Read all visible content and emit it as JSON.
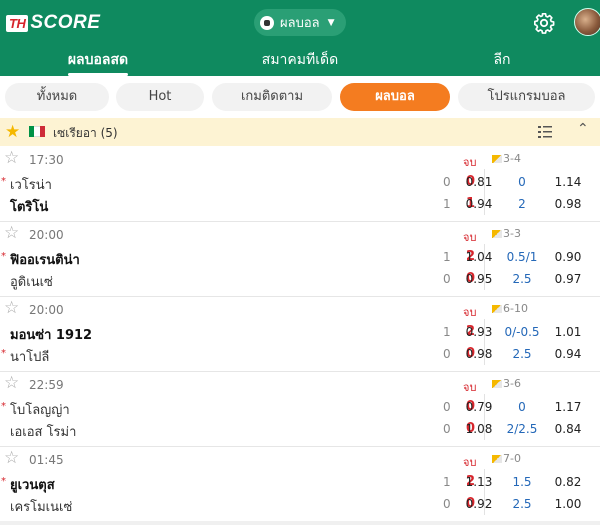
{
  "header": {
    "logo_th": "TH",
    "logo_score": "SCORE",
    "sport": "ผลบอล",
    "icons": {
      "settings": "gear-icon",
      "avatar": "user-avatar"
    }
  },
  "tabs": [
    {
      "label": "ผลบอลสด",
      "active": true
    },
    {
      "label": "สมาคมทีเด็ด",
      "active": false,
      "badge": "flame-icon"
    },
    {
      "label": "ลีก",
      "active": false
    }
  ],
  "filters": [
    {
      "label": "ทั้งหมด",
      "active": false
    },
    {
      "label": "Hot",
      "active": false
    },
    {
      "label": "เกมติดตาม",
      "active": false
    },
    {
      "label": "ผลบอล",
      "active": true
    },
    {
      "label": "โปรแกรมบอล",
      "active": false
    }
  ],
  "league": {
    "name": "เซเรียอา (5)",
    "flag_colors": [
      "#009246",
      "#ffffff",
      "#ce2b37"
    ]
  },
  "matches": [
    {
      "time": "17:30",
      "status": "จบ",
      "handicap": "3-4",
      "home": {
        "name": "เวโรน่า",
        "ht": "0",
        "ft": "0",
        "red": true,
        "win": false
      },
      "away": {
        "name": "โตริโน่",
        "ht": "1",
        "ft": "1",
        "red": false,
        "win": true
      },
      "odds_top": [
        "0.81",
        "0",
        "1.14"
      ],
      "odds_bottom": [
        "0.94",
        "2",
        "0.98"
      ]
    },
    {
      "time": "20:00",
      "status": "จบ",
      "handicap": "3-3",
      "home": {
        "name": "ฟิออเรนติน่า",
        "ht": "1",
        "ft": "2",
        "red": true,
        "win": true
      },
      "away": {
        "name": "อูดิเนเซ่",
        "ht": "0",
        "ft": "0",
        "red": false,
        "win": false
      },
      "odds_top": [
        "1.04",
        "0.5/1",
        "0.90"
      ],
      "odds_bottom": [
        "0.95",
        "2.5",
        "0.97"
      ]
    },
    {
      "time": "20:00",
      "status": "จบ",
      "handicap": "6-10",
      "home": {
        "name": "มอนซ่า 1912",
        "ht": "1",
        "ft": "2",
        "red": false,
        "win": true
      },
      "away": {
        "name": "นาโปลี",
        "ht": "0",
        "ft": "0",
        "red": true,
        "win": false
      },
      "odds_top": [
        "0.93",
        "0/-0.5",
        "1.01"
      ],
      "odds_bottom": [
        "0.98",
        "2.5",
        "0.94"
      ]
    },
    {
      "time": "22:59",
      "status": "จบ",
      "handicap": "3-6",
      "home": {
        "name": "โบโลญญ่า",
        "ht": "0",
        "ft": "0",
        "red": true,
        "win": false
      },
      "away": {
        "name": "เอเอส โรม่า",
        "ht": "0",
        "ft": "0",
        "red": false,
        "win": false
      },
      "odds_top": [
        "0.79",
        "0",
        "1.17"
      ],
      "odds_bottom": [
        "1.08",
        "2/2.5",
        "0.84"
      ]
    },
    {
      "time": "01:45",
      "status": "จบ",
      "handicap": "7-0",
      "home": {
        "name": "ยูเวนตุส",
        "ht": "1",
        "ft": "2",
        "red": true,
        "win": true
      },
      "away": {
        "name": "เครโมเนเซ่",
        "ht": "0",
        "ft": "0",
        "red": false,
        "win": false
      },
      "odds_top": [
        "1.13",
        "1.5",
        "0.82"
      ],
      "odds_bottom": [
        "0.92",
        "2.5",
        "1.00"
      ]
    }
  ]
}
